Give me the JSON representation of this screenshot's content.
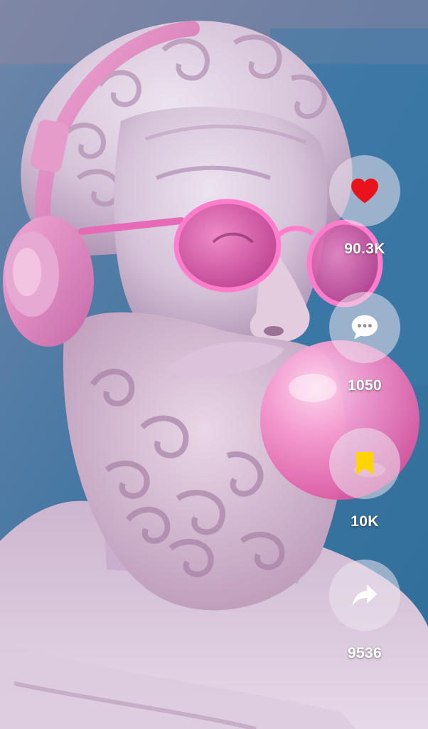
{
  "actions": {
    "like": {
      "icon": "heart-icon",
      "count": "90.3K",
      "color": "#e8131c"
    },
    "comment": {
      "icon": "comment-bubble-icon",
      "count": "1050",
      "color": "#ffffff"
    },
    "save": {
      "icon": "bookmark-icon",
      "count": "10K",
      "color": "#ffd400"
    },
    "share": {
      "icon": "share-arrow-icon",
      "count": "9536",
      "color": "#ffffff"
    }
  }
}
